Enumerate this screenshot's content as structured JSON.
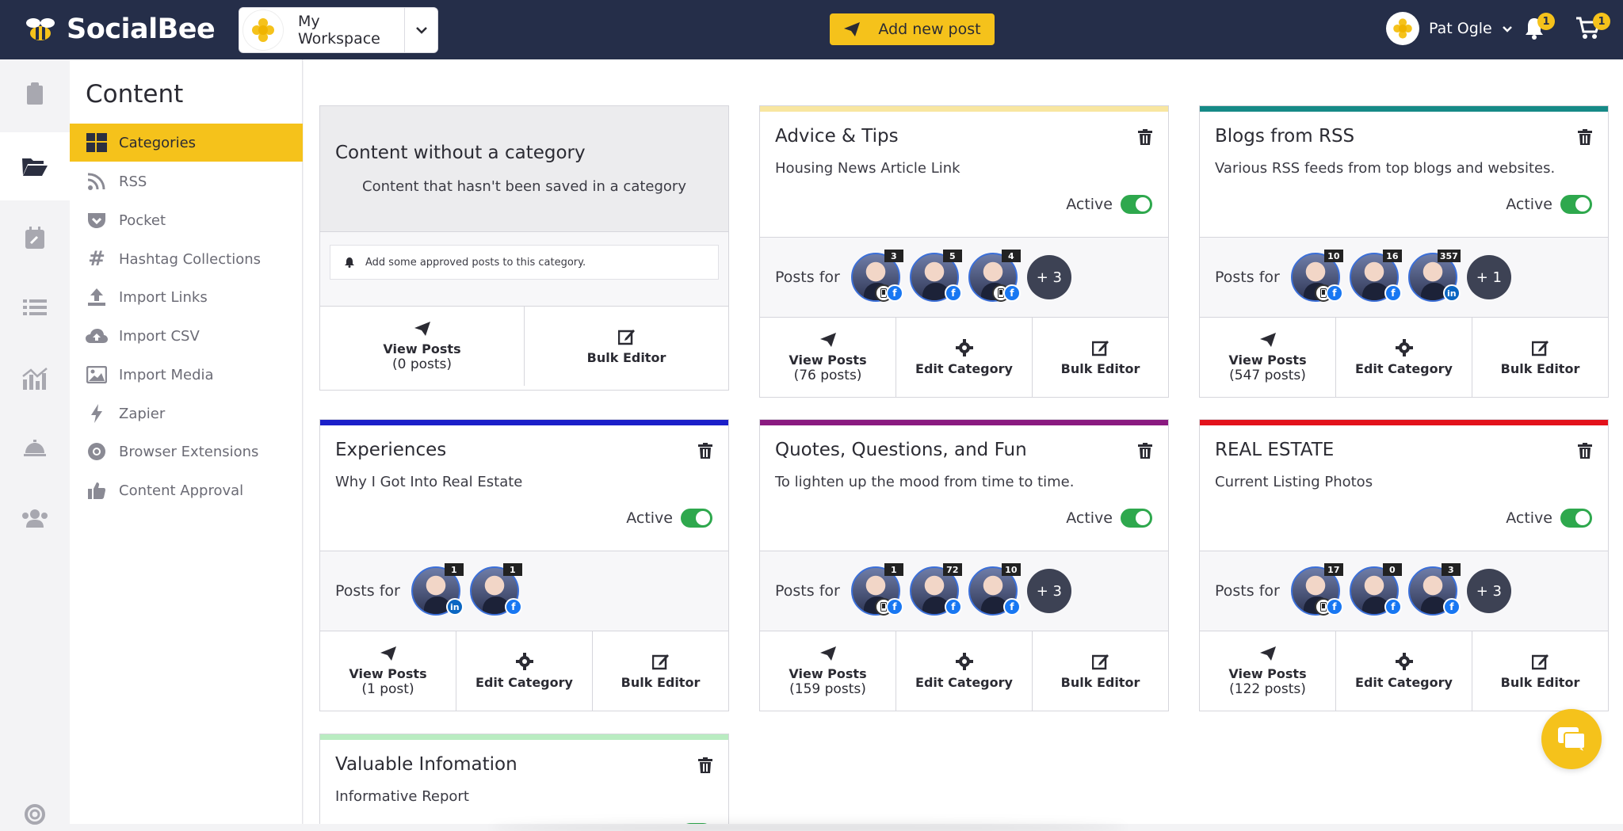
{
  "topbar": {
    "brand": "SocialBee",
    "workspace_name": "My Workspace",
    "add_post_label": "Add new post",
    "user_name": "Pat Ogle",
    "notifications_count": "1",
    "cart_count": "1"
  },
  "submenu": {
    "title": "Content",
    "items": [
      {
        "label": "Categories",
        "icon": "categories-grid-icon"
      },
      {
        "label": "RSS",
        "icon": "rss-icon"
      },
      {
        "label": "Pocket",
        "icon": "pocket-icon"
      },
      {
        "label": "Hashtag Collections",
        "icon": "hashtag-icon"
      },
      {
        "label": "Import Links",
        "icon": "upload-icon"
      },
      {
        "label": "Import CSV",
        "icon": "cloud-upload-icon"
      },
      {
        "label": "Import Media",
        "icon": "image-icon"
      },
      {
        "label": "Zapier",
        "icon": "bolt-icon"
      },
      {
        "label": "Browser Extensions",
        "icon": "chrome-icon"
      },
      {
        "label": "Content Approval",
        "icon": "thumbs-up-icon"
      }
    ]
  },
  "colors": {
    "accent": "#f5c21b",
    "topbar": "#252e49",
    "toggle_on": "#2ea84d"
  },
  "nocat": {
    "title": "Content without a category",
    "desc": "Content that hasn't been saved in a category",
    "note": "Add some approved posts to this category.",
    "view_label": "View Posts",
    "view_count": "(0 posts)",
    "bulk_label": "Bulk Editor"
  },
  "labels": {
    "active": "Active",
    "posts_for": "Posts for",
    "view_posts": "View Posts",
    "edit_category": "Edit Category",
    "bulk_editor": "Bulk Editor"
  },
  "cards": [
    {
      "title": "Advice & Tips",
      "desc": "Housing News Article Link",
      "color": "#f8e6a0",
      "count": "(76 posts)",
      "profiles": [
        {
          "n": "3",
          "net": "fb",
          "dev": true
        },
        {
          "n": "5",
          "net": "fb"
        },
        {
          "n": "4",
          "net": "fb",
          "dev": true
        }
      ],
      "more": "+ 3"
    },
    {
      "title": "Blogs from RSS",
      "desc": "Various RSS feeds from top blogs and websites.",
      "color": "#168a87",
      "count": "(547 posts)",
      "profiles": [
        {
          "n": "10",
          "net": "fb",
          "dev": true
        },
        {
          "n": "16",
          "net": "fb"
        },
        {
          "n": "357",
          "net": "li"
        }
      ],
      "more": "+ 1"
    },
    {
      "title": "Experiences",
      "desc": "Why I Got Into Real Estate",
      "color": "#1b1fc9",
      "count": "(1 post)",
      "profiles": [
        {
          "n": "1",
          "net": "li"
        },
        {
          "n": "1",
          "net": "fb"
        }
      ],
      "more": ""
    },
    {
      "title": "Quotes, Questions, and Fun",
      "desc": "To lighten up the mood from time to time.",
      "color": "#8a1a80",
      "count": "(159 posts)",
      "profiles": [
        {
          "n": "1",
          "net": "fb",
          "dev": true
        },
        {
          "n": "72",
          "net": "fb"
        },
        {
          "n": "10",
          "net": "fb"
        }
      ],
      "more": "+ 3"
    },
    {
      "title": "REAL ESTATE",
      "desc": "Current Listing Photos",
      "color": "#e3121b",
      "count": "(122 posts)",
      "profiles": [
        {
          "n": "17",
          "net": "fb",
          "dev": true
        },
        {
          "n": "0",
          "net": "fb"
        },
        {
          "n": "3",
          "net": "fb"
        }
      ],
      "more": "+ 3"
    },
    {
      "title": "Valuable Infomation",
      "desc": "Informative Report",
      "color": "#b9ecc1",
      "count": "",
      "profiles": [],
      "more": ""
    }
  ]
}
